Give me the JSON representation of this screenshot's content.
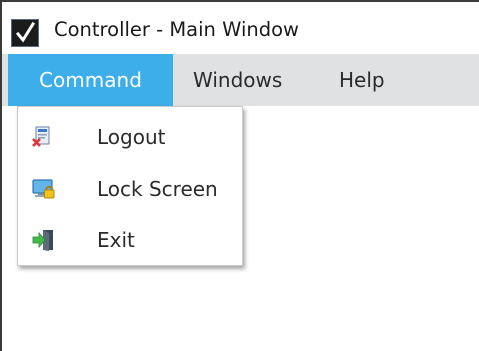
{
  "window": {
    "title": "Controller - Main Window",
    "app_icon": "checkmark-app-icon"
  },
  "menubar": {
    "items": [
      {
        "label": "Command",
        "active": true
      },
      {
        "label": "Windows",
        "active": false
      },
      {
        "label": "Help",
        "active": false
      }
    ]
  },
  "dropdown": {
    "parent": "Command",
    "items": [
      {
        "label": "Logout",
        "icon": "logout-icon"
      },
      {
        "label": "Lock Screen",
        "icon": "lock-screen-icon"
      },
      {
        "label": "Exit",
        "icon": "exit-icon"
      }
    ]
  },
  "colors": {
    "menubar_bg": "#dfe1e3",
    "active_menu_bg": "#3daee9",
    "active_menu_text": "#ffffff",
    "text": "#2b2b2b"
  }
}
